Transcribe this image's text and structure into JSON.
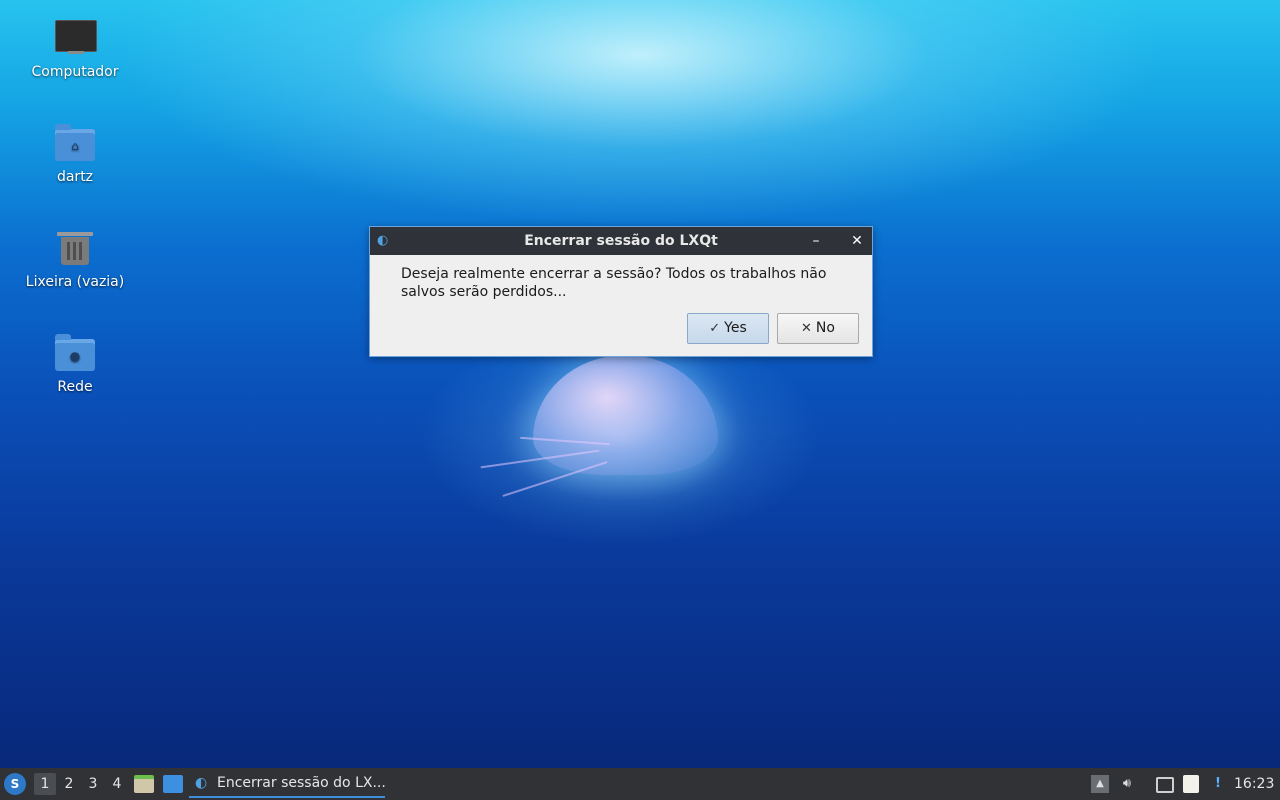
{
  "desktop": {
    "icons": [
      {
        "label": "Computador",
        "icon": "computer-icon"
      },
      {
        "label": "dartz",
        "icon": "home-folder-icon"
      },
      {
        "label": "Lixeira (vazia)",
        "icon": "trash-icon"
      },
      {
        "label": "Rede",
        "icon": "network-folder-icon"
      }
    ]
  },
  "dialog": {
    "title": "Encerrar sessão do LXQt",
    "message": "Deseja realmente encerrar a sessão? Todos os trabalhos não salvos serão perdidos...",
    "yes_label": "Yes",
    "no_label": "No",
    "minimize_glyph": "–",
    "close_glyph": "✕",
    "app_icon": "lxqt-logo-icon"
  },
  "taskbar": {
    "desktops": [
      "1",
      "2",
      "3",
      "4"
    ],
    "active_desktop": "1",
    "task_label": "Encerrar sessão do LX...",
    "clock": "16:23",
    "tray_icons": [
      "tray-arrow-icon",
      "volume-icon",
      "network-icon",
      "clipboard-icon",
      "update-notifier-icon"
    ]
  },
  "colors": {
    "taskbar_bg": "#303236",
    "dialog_titlebar": "#2f3238",
    "accent": "#3f8edb"
  }
}
